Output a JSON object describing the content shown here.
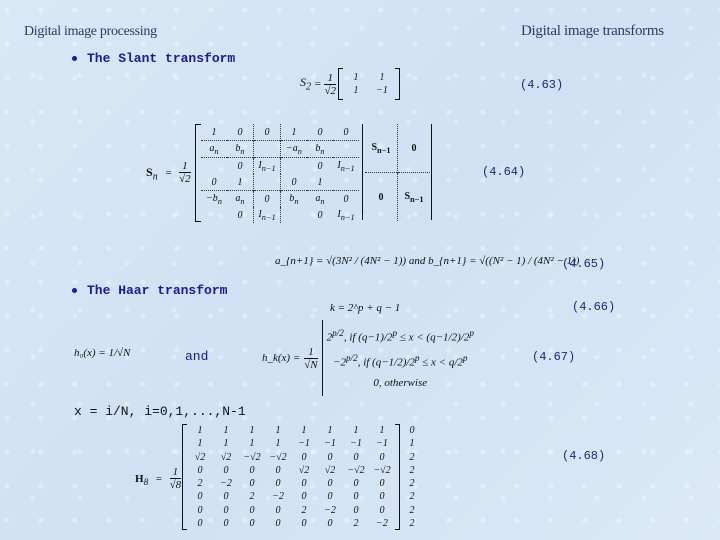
{
  "header": {
    "left_title": "Digital image processing",
    "right_title": "Digital image transforms"
  },
  "slant": {
    "bullet": "The Slant transform",
    "eq63": {
      "lhs": "S",
      "lhs_sub": "2",
      "coef_num": "1",
      "coef_den": "√2",
      "matrix": [
        [
          "1",
          "1"
        ],
        [
          "1",
          "−1"
        ]
      ],
      "number": "(4.63)"
    },
    "eq64": {
      "lhs": "S",
      "lhs_sub": "n",
      "coef_num": "1",
      "coef_den": "√2",
      "left_block": [
        [
          "1",
          "0",
          "0",
          "1",
          "0",
          "0"
        ],
        [
          "a_n",
          "b_n",
          "",
          "−a_n",
          "b_n",
          ""
        ],
        [
          "",
          "0",
          "I_{n−1}",
          "",
          "0",
          "I_{n−1}"
        ],
        [
          "0",
          "1",
          "",
          "0",
          "1",
          ""
        ],
        [
          "−b_n",
          "a_n",
          "0",
          "b_n",
          "a_n",
          "0"
        ],
        [
          "",
          "0",
          "I_{n−1}",
          "",
          "0",
          "I_{n−1}"
        ]
      ],
      "right_block": [
        [
          "S_{n−1}",
          "0"
        ],
        [
          "0",
          "S_{n−1}"
        ]
      ],
      "number": "(4.64)"
    },
    "eq65": {
      "a_text": "a_{n+1} = √(3N² / (4N² − 1))",
      "and_text": "and",
      "b_text": "b_{n+1} = √((N² − 1) / (4N² − 1))",
      "number": "(4.65)"
    }
  },
  "haar": {
    "bullet": "The Haar transform",
    "eq66": {
      "text": "k = 2^p + q − 1",
      "number": "(4.66)"
    },
    "eq67": {
      "h0": "h₀(x) = 1/√N",
      "and_label": "and",
      "hk_lhs": "h_k(x) =",
      "coef_num": "1",
      "coef_den": "√N",
      "cases": [
        "2^{p/2}, if (q−1)/2^p ≤ x < (q−1/2)/2^p",
        "−2^{p/2}, if (q−1/2)/2^p ≤ x < q/2^p",
        "0, otherwise"
      ],
      "number": "(4.67)"
    },
    "xdef": "x = i/N,  i=0,1,...,N-1",
    "eq68": {
      "lhs": "H",
      "lhs_sub": "8",
      "coef_num": "1",
      "coef_den": "√8",
      "matrix": [
        [
          "1",
          "1",
          "1",
          "1",
          "1",
          "1",
          "1",
          "1"
        ],
        [
          "1",
          "1",
          "1",
          "1",
          "−1",
          "−1",
          "−1",
          "−1"
        ],
        [
          "√2",
          "√2",
          "−√2",
          "−√2",
          "0",
          "0",
          "0",
          "0"
        ],
        [
          "0",
          "0",
          "0",
          "0",
          "√2",
          "√2",
          "−√2",
          "−√2"
        ],
        [
          "2",
          "−2",
          "0",
          "0",
          "0",
          "0",
          "0",
          "0"
        ],
        [
          "0",
          "0",
          "2",
          "−2",
          "0",
          "0",
          "0",
          "0"
        ],
        [
          "0",
          "0",
          "0",
          "0",
          "2",
          "−2",
          "0",
          "0"
        ],
        [
          "0",
          "0",
          "0",
          "0",
          "0",
          "0",
          "2",
          "−2"
        ]
      ],
      "row_labels": [
        "0",
        "1",
        "2",
        "2",
        "2",
        "2",
        "2",
        "2"
      ],
      "number": "(4.68)"
    }
  }
}
